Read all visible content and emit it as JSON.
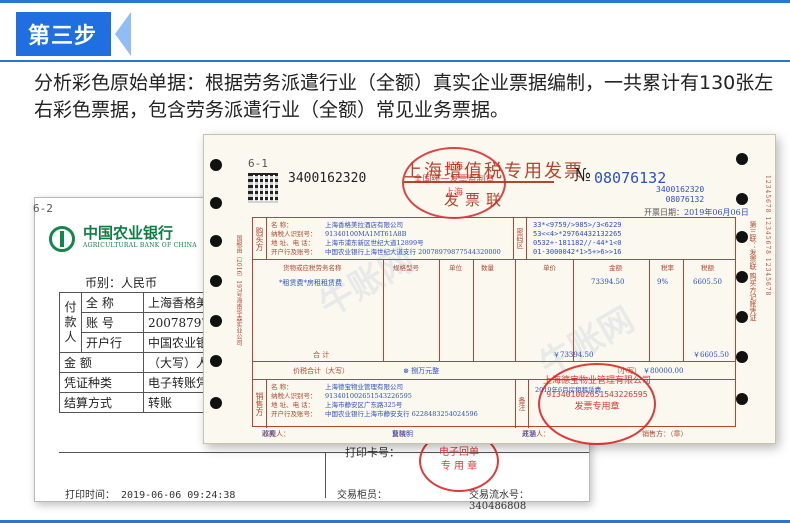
{
  "header": {
    "step_label": "第三步",
    "intro_text": "分析彩色原始单据：根据劳务派遣行业（全额）真实企业票据编制，一共累计有130张左右彩色票据，包含劳务派遣行业（全额）常见业务票据。"
  },
  "bank_receipt": {
    "form_code": "6-2",
    "bank_name": "中国农业银行",
    "bank_name_en": "AGRICULTURAL BANK OF CHINA",
    "currency": "币别：人民币",
    "payer_label": "付款人",
    "rows": [
      {
        "label": "全 称",
        "value": "上海香格美拉"
      },
      {
        "label": "账 号",
        "value": "200787979877"
      },
      {
        "label": "开户行",
        "value": "中国农业银行"
      }
    ],
    "amount_label": "金 额",
    "amount_value": "（大写）人民",
    "voucher_type_label": "凭证种类",
    "voucher_type_value": "电子转账凭证",
    "settle_label": "结算方式",
    "settle_value": "转账",
    "print_card": "打印卡号：",
    "print_time": "打印时间：  2019-06-06 09:24:38",
    "teller": "交易柜员：",
    "serial_no": "交易流水号：  340486808",
    "stamp_line1": "电子回单",
    "stamp_line2": "专 用 章"
  },
  "invoice": {
    "form_code": "6-1",
    "code": "3400162320",
    "title": "上海增值税专用发票",
    "subtitle": "发票联",
    "no_mark": "№",
    "number": "08076132",
    "small_code": "3400162320",
    "small_number": "08076132",
    "date_label": "开票日期：",
    "date_value": "2019年06月06日",
    "buyer_side": "购买方",
    "buyer_labels": [
      "名 称：",
      "纳税人识别号：",
      "地 址、电 话：",
      "开户行及账号："
    ],
    "buyer_values": [
      "上海香格美拉酒店有限公司",
      "91340100MA1MT61A8B",
      "上海市浦东新区世纪大道12899号",
      "中国农业银行上海世纪大道支行 20078979877544320000"
    ],
    "pw_label": "密码区",
    "pw_values": [
      "33*<9759/>985>/3<6229",
      "53<<4>*29764432132265",
      "0532+-181182//-44*1<0",
      "01-3000042*1>5+>6>>16"
    ],
    "col_headers": [
      "货物或应税劳务名称",
      "规格型号",
      "单位",
      "数量",
      "单价",
      "金额",
      "税率",
      "税额"
    ],
    "item_name": "*租赁费*房租租赁费",
    "item_amount": "73394.50",
    "item_rate": "9%",
    "item_tax": "6605.50",
    "sum_label": "合  计",
    "sum_amount": "￥73394.50",
    "sum_tax": "￥6605.50",
    "total_label": "价税合计（大写）",
    "total_words": "⊗ 捌万元整",
    "total_small_label": "（小写）",
    "total_num": "￥80000.00",
    "seller_side": "销售方",
    "seller_values": [
      "上海德宝物业管理有限公司",
      "91340100265154322659​5",
      "上海市静安区广东路325号",
      "中国农业银行上海市静安支行 6228483254024596"
    ],
    "remark_label": "备注",
    "remark_value": "2019年6月房租租赁费",
    "sig_payee": "收款人：",
    "sig_payee_val": "邓亮",
    "sig_review": "复核：",
    "sig_review_val": "曹晓明",
    "sig_issuer": "开票人：",
    "sig_issuer_val": "成涵",
    "sig_seller": "销售方：（章）",
    "right_strip": "第三联：发票联 购买方记账凭证",
    "side_notes": "国税函〔2016〕197号海南华森实业公司",
    "tax_seal_line1": "上海",
    "tax_seal_line2": "全国统一发票监制章",
    "tax_seal_line3": "上海",
    "seller_seal_line1": "上海德宝物业管理有限公司",
    "seller_seal_line2": "913401002651543226595",
    "seller_seal_line3": "发票专用章",
    "serial_strip": "12345678 12345678 12345678"
  },
  "watermark": {
    "text": "牛账网"
  }
}
